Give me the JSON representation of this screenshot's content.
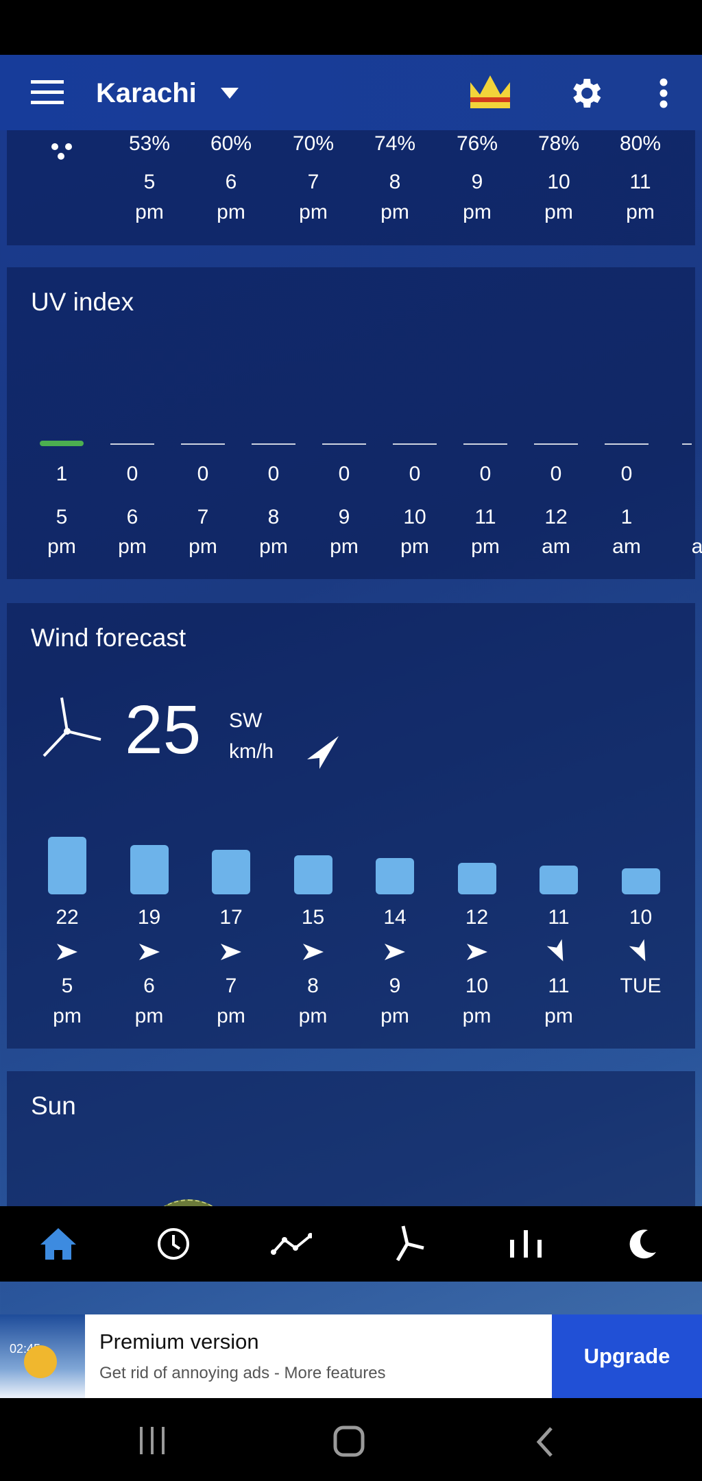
{
  "header": {
    "city": "Karachi",
    "icons": [
      "menu-icon",
      "dropdown-icon",
      "crown-icon",
      "gear-icon",
      "more-vert-icon"
    ]
  },
  "humidity": {
    "icon": "humidity-drops-icon",
    "values": [
      "53%",
      "60%",
      "70%",
      "74%",
      "76%",
      "78%",
      "80%"
    ],
    "hours": [
      [
        "5",
        "pm"
      ],
      [
        "6",
        "pm"
      ],
      [
        "7",
        "pm"
      ],
      [
        "8",
        "pm"
      ],
      [
        "9",
        "pm"
      ],
      [
        "10",
        "pm"
      ],
      [
        "11",
        "pm"
      ]
    ]
  },
  "uv": {
    "title": "UV index",
    "values": [
      "1",
      "0",
      "0",
      "0",
      "0",
      "0",
      "0",
      "0",
      "0"
    ],
    "hours": [
      [
        "5",
        "pm"
      ],
      [
        "6",
        "pm"
      ],
      [
        "7",
        "pm"
      ],
      [
        "8",
        "pm"
      ],
      [
        "9",
        "pm"
      ],
      [
        "10",
        "pm"
      ],
      [
        "11",
        "pm"
      ],
      [
        "12",
        "am"
      ],
      [
        "1",
        "am"
      ],
      [
        "",
        "a"
      ]
    ],
    "active_color": "#4caf50"
  },
  "wind": {
    "title": "Wind forecast",
    "speed": "25",
    "direction": "SW",
    "unit": "km/h",
    "bar_color": "#6db3ea",
    "values": [
      22,
      19,
      17,
      15,
      14,
      12,
      11,
      10
    ],
    "arrows": [
      "east",
      "east",
      "east",
      "east",
      "east",
      "east",
      "south-southeast",
      "south-southeast"
    ],
    "hours": [
      [
        "5",
        "pm"
      ],
      [
        "6",
        "pm"
      ],
      [
        "7",
        "pm"
      ],
      [
        "8",
        "pm"
      ],
      [
        "9",
        "pm"
      ],
      [
        "10",
        "pm"
      ],
      [
        "11",
        "pm"
      ],
      [
        "TUE",
        ""
      ]
    ]
  },
  "sun": {
    "title": "Sun"
  },
  "bottom_nav": [
    {
      "name": "home",
      "active": true
    },
    {
      "name": "clock"
    },
    {
      "name": "graph"
    },
    {
      "name": "wind"
    },
    {
      "name": "bars"
    },
    {
      "name": "moon"
    }
  ],
  "ad": {
    "title": "Premium version",
    "subtitle": "Get rid of annoying ads - More features",
    "button": "Upgrade",
    "thumb_time": "02:45"
  }
}
